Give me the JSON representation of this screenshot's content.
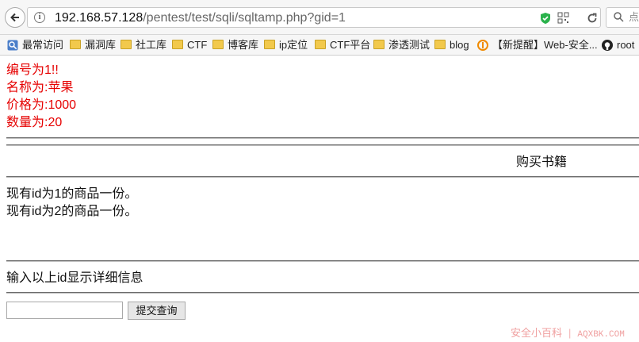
{
  "browser": {
    "url_host": "192.168.57.128",
    "url_path": "/pentest/test/sqli/sqltamp.php?gid=1",
    "search_hint": "点"
  },
  "bookmarks": [
    {
      "label": "最常访问",
      "icon": "most-visited-icon"
    },
    {
      "label": "漏洞库",
      "icon": "folder-icon"
    },
    {
      "label": "社工库",
      "icon": "folder-icon"
    },
    {
      "label": "CTF",
      "icon": "folder-icon"
    },
    {
      "label": "博客库",
      "icon": "folder-icon"
    },
    {
      "label": "ip定位",
      "icon": "folder-icon"
    },
    {
      "label": "CTF平台",
      "icon": "folder-icon"
    },
    {
      "label": "渗透测试",
      "icon": "folder-icon"
    },
    {
      "label": "blog",
      "icon": "folder-icon"
    },
    {
      "label": "【新提醒】Web-安全...",
      "icon": "site-logo-icon"
    },
    {
      "label": "root",
      "icon": "github-icon"
    }
  ],
  "product": {
    "id_line": "编号为1!!",
    "name_line": "名称为:苹果",
    "price_line": "价格为:1000",
    "qty_line": "数量为:20"
  },
  "buy_title": "购买书籍",
  "inventory": [
    "现有id为1的商品一份。",
    "现有id为2的商品一份。"
  ],
  "prompt": "输入以上id显示详细信息",
  "form": {
    "input_value": "",
    "submit_label": "提交查询"
  },
  "watermark": {
    "site": "安全小百科",
    "domain": "AQXBK.COM"
  },
  "colors": {
    "product_text": "#e60000",
    "folder": "#f2c94c"
  }
}
